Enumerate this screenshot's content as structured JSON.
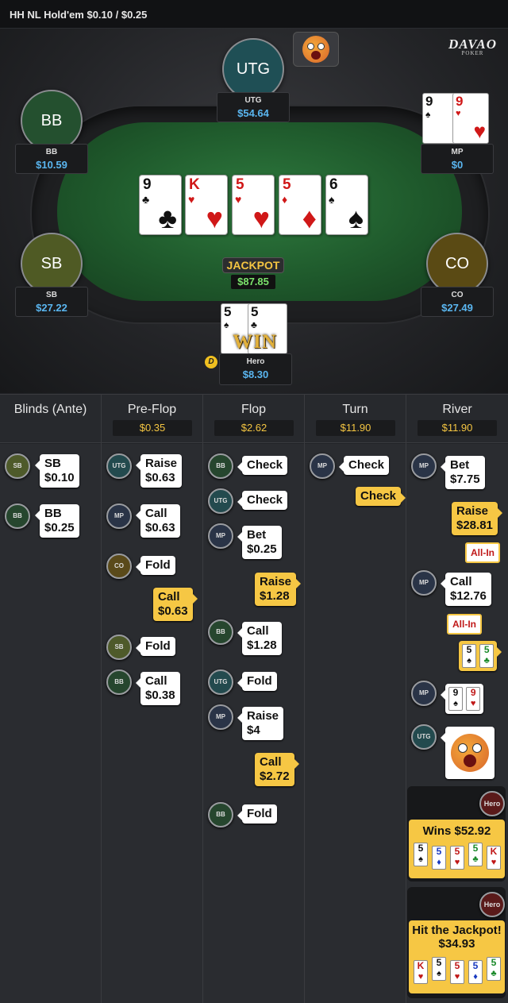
{
  "title": "HH NL Hold'em $0.10 / $0.25",
  "brand": {
    "name": "DAVAO",
    "sub": "POKER"
  },
  "seats": {
    "utg": {
      "avatar": "UTG",
      "name": "UTG",
      "stack": "$54.64",
      "color": "#1f4f55"
    },
    "bb": {
      "avatar": "BB",
      "name": "BB",
      "stack": "$10.59",
      "color": "#24502f"
    },
    "mp": {
      "name": "MP",
      "stack": "$0"
    },
    "sb": {
      "avatar": "SB",
      "name": "SB",
      "stack": "$27.22",
      "color": "#4f5a24"
    },
    "co": {
      "avatar": "CO",
      "name": "CO",
      "stack": "$27.49",
      "color": "#5a4a14"
    },
    "hero": {
      "name": "Hero",
      "stack": "$8.30"
    }
  },
  "mp_cards": [
    {
      "rank": "9",
      "suit": "♠",
      "color": "black"
    },
    {
      "rank": "9",
      "suit": "♥",
      "color": "red"
    }
  ],
  "hero_cards": [
    {
      "rank": "5",
      "suit": "♠",
      "color": "black"
    },
    {
      "rank": "5",
      "suit": "♣",
      "color": "black"
    }
  ],
  "board": [
    {
      "rank": "9",
      "suit": "♣",
      "color": "black"
    },
    {
      "rank": "K",
      "suit": "♥",
      "color": "red"
    },
    {
      "rank": "5",
      "suit": "♥",
      "color": "red"
    },
    {
      "rank": "5",
      "suit": "♦",
      "color": "red"
    },
    {
      "rank": "6",
      "suit": "♠",
      "color": "black"
    }
  ],
  "jackpot": {
    "label": "JACKPOT",
    "value": "$87.85"
  },
  "win_badge": "WIN",
  "dealer_button": "D",
  "history": {
    "columns": [
      {
        "title": "Blinds (Ante)",
        "pot": ""
      },
      {
        "title": "Pre-Flop",
        "pot": "$0.35"
      },
      {
        "title": "Flop",
        "pot": "$2.62"
      },
      {
        "title": "Turn",
        "pot": "$11.90"
      },
      {
        "title": "River",
        "pot": "$11.90"
      }
    ],
    "blinds": [
      {
        "pos": "SB",
        "line1": "SB",
        "line2": "$0.10"
      },
      {
        "pos": "BB",
        "line1": "BB",
        "line2": "$0.25"
      }
    ],
    "preflop": [
      {
        "pos": "UTG",
        "line1": "Raise",
        "line2": "$0.63"
      },
      {
        "pos": "MP",
        "line1": "Call",
        "line2": "$0.63"
      },
      {
        "pos": "CO",
        "line1": "Fold"
      },
      {
        "pos": "Hero",
        "line1": "Call",
        "line2": "$0.63"
      },
      {
        "pos": "SB",
        "line1": "Fold"
      },
      {
        "pos": "BB",
        "line1": "Call",
        "line2": "$0.38"
      }
    ],
    "flop": [
      {
        "pos": "BB",
        "line1": "Check"
      },
      {
        "pos": "UTG",
        "line1": "Check"
      },
      {
        "pos": "MP",
        "line1": "Bet",
        "line2": "$0.25"
      },
      {
        "pos": "Hero",
        "line1": "Raise",
        "line2": "$1.28"
      },
      {
        "pos": "BB",
        "line1": "Call",
        "line2": "$1.28"
      },
      {
        "pos": "UTG",
        "line1": "Fold"
      },
      {
        "pos": "MP",
        "line1": "Raise",
        "line2": "$4"
      },
      {
        "pos": "Hero",
        "line1": "Call",
        "line2": "$2.72"
      },
      {
        "pos": "BB",
        "line1": "Fold"
      }
    ],
    "turn": [
      {
        "pos": "MP",
        "line1": "Check"
      },
      {
        "pos": "Hero",
        "line1": "Check"
      }
    ],
    "river": [
      {
        "pos": "MP",
        "line1": "Bet",
        "line2": "$7.75"
      },
      {
        "pos": "Hero",
        "line1": "Raise",
        "line2": "$28.81",
        "tag": "All-In"
      },
      {
        "pos": "MP",
        "line1": "Call",
        "line2": "$12.76",
        "tag": "All-In"
      }
    ],
    "showdown": {
      "hero_cards": [
        {
          "rank": "5",
          "suit": "♠",
          "color": "black"
        },
        {
          "rank": "5",
          "suit": "♣",
          "color": "green"
        }
      ],
      "mp_cards": [
        {
          "rank": "9",
          "suit": "♠",
          "color": "black"
        },
        {
          "rank": "9",
          "suit": "♥",
          "color": "red"
        }
      ]
    },
    "results": [
      {
        "pos": "Hero",
        "text": "Wins $52.92",
        "cards": [
          {
            "rank": "5",
            "suit": "♠",
            "color": "black"
          },
          {
            "rank": "5",
            "suit": "♦",
            "color": "blue"
          },
          {
            "rank": "5",
            "suit": "♥",
            "color": "red"
          },
          {
            "rank": "5",
            "suit": "♣",
            "color": "green"
          },
          {
            "rank": "K",
            "suit": "♥",
            "color": "red"
          }
        ]
      },
      {
        "pos": "Hero",
        "text1": "Hit the Jackpot!",
        "text2": "$34.93",
        "cards": [
          {
            "rank": "K",
            "suit": "♥",
            "color": "red"
          },
          {
            "rank": "5",
            "suit": "♠",
            "color": "black"
          },
          {
            "rank": "5",
            "suit": "♥",
            "color": "red"
          },
          {
            "rank": "5",
            "suit": "♦",
            "color": "blue"
          },
          {
            "rank": "5",
            "suit": "♣",
            "color": "green"
          }
        ]
      }
    ]
  },
  "colors": {
    "stack_blue": "#5ab6f0",
    "gold": "#f4c542",
    "hero_bubble": "#f6c744",
    "felt": "#1f5a2c"
  }
}
